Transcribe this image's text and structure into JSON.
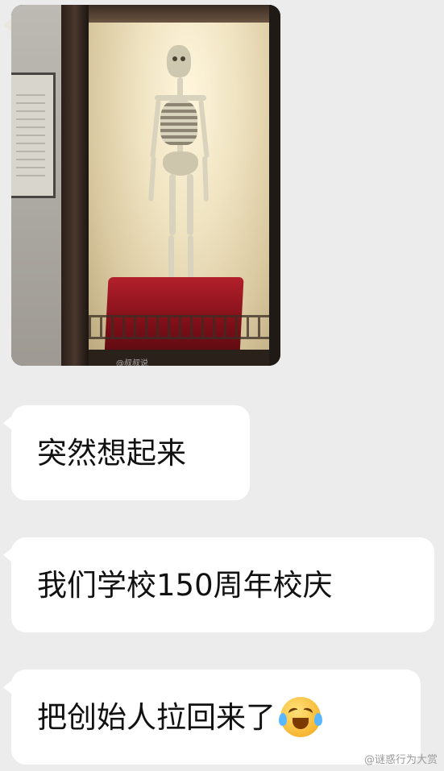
{
  "messages": [
    {
      "type": "image",
      "alt": "skeleton in display case"
    },
    {
      "type": "text",
      "text": "突然想起来"
    },
    {
      "type": "text",
      "text": "我们学校150周年校庆"
    },
    {
      "type": "text",
      "text": "把创始人拉回来了",
      "emoji": "crying-laughing-emoji"
    }
  ],
  "photo_watermark": "@叔叔说",
  "page_watermark": "@谜惑行为大赏",
  "colors": {
    "background": "#ececec",
    "bubble": "#ffffff",
    "text": "#111111"
  }
}
